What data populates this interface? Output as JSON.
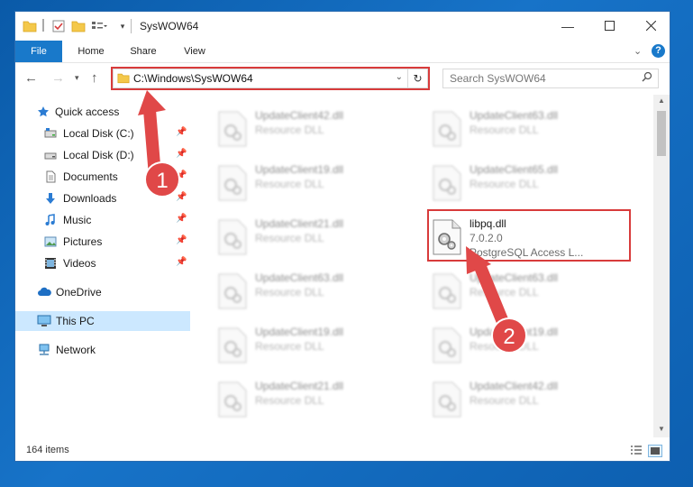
{
  "window": {
    "title": "SysWOW64",
    "controls": [
      "minimize-icon",
      "maximize-icon",
      "close-icon"
    ]
  },
  "ribbon": {
    "tabs": [
      {
        "label": "File"
      },
      {
        "label": "Home"
      },
      {
        "label": "Share"
      },
      {
        "label": "View"
      }
    ]
  },
  "address": {
    "path": "C:\\Windows\\SysWOW64",
    "search_placeholder": "Search SysWOW64"
  },
  "sidebar": {
    "items": [
      {
        "label": "Quick access",
        "icon": "star-icon"
      },
      {
        "label": "Local Disk (C:)",
        "icon": "drive-icon",
        "pinned": true
      },
      {
        "label": "Local Disk (D:)",
        "icon": "drive-icon",
        "pinned": true
      },
      {
        "label": "Documents",
        "icon": "documents-icon",
        "pinned": true
      },
      {
        "label": "Downloads",
        "icon": "download-icon",
        "pinned": true
      },
      {
        "label": "Music",
        "icon": "music-icon",
        "pinned": true
      },
      {
        "label": "Pictures",
        "icon": "pictures-icon",
        "pinned": true
      },
      {
        "label": "Videos",
        "icon": "videos-icon",
        "pinned": true
      },
      {
        "label": "OneDrive",
        "icon": "cloud-icon"
      },
      {
        "label": "This PC",
        "icon": "computer-icon",
        "selected": true
      },
      {
        "label": "Network",
        "icon": "network-icon"
      }
    ]
  },
  "files": {
    "left": [
      {
        "name": "UpdateClient42.dll",
        "desc": "Resource DLL"
      },
      {
        "name": "UpdateClient19.dll",
        "desc": "Resource DLL"
      },
      {
        "name": "UpdateClient21.dll",
        "desc": "Resource DLL"
      },
      {
        "name": "UpdateClient63.dll",
        "desc": "Resource DLL"
      },
      {
        "name": "UpdateClient19.dll",
        "desc": "Resource DLL"
      },
      {
        "name": "UpdateClient21.dll",
        "desc": "Resource DLL"
      }
    ],
    "right": [
      {
        "name": "UpdateClient63.dll",
        "desc": "Resource DLL"
      },
      {
        "name": "UpdateClient65.dll",
        "desc": "Resource DLL"
      },
      {
        "name": "libpq.dll",
        "version": "7.0.2.0",
        "desc": "PostgreSQL Access L...",
        "highlighted": true
      },
      {
        "name": "UpdateClient63.dll",
        "desc": "Resource DLL"
      },
      {
        "name": "UpdateClient19.dll",
        "desc": "Resource DLL"
      },
      {
        "name": "UpdateClient42.dll",
        "desc": "Resource DLL"
      }
    ]
  },
  "status": {
    "item_count": "164 items"
  },
  "annotations": {
    "step1": "1",
    "step2": "2",
    "color": "#e04848"
  },
  "colors": {
    "accent": "#1979ca",
    "selection": "#cce8ff",
    "highlight_box": "#d83b3b"
  }
}
